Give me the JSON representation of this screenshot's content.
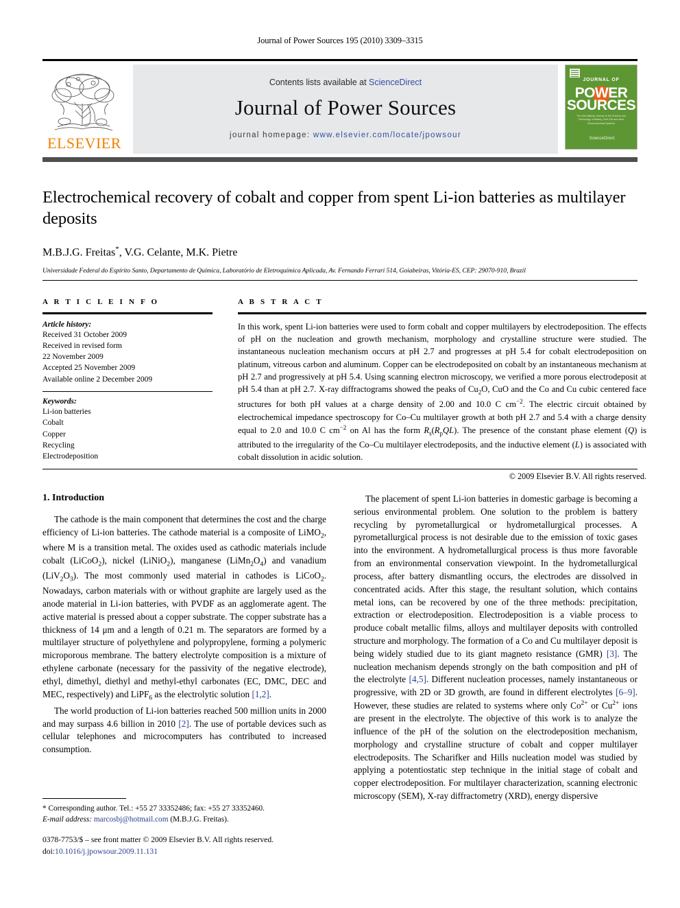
{
  "running_head": "Journal of Power Sources 195 (2010) 3309–3315",
  "masthead": {
    "publisher_name": "ELSEVIER",
    "contents_prefix": "Contents lists available at ",
    "contents_link": "ScienceDirect",
    "journal_name": "Journal of Power Sources",
    "homepage_prefix": "journal homepage: ",
    "homepage_url": "www.elsevier.com/locate/jpowsour",
    "cover": {
      "line1": "JOURNAL OF",
      "line2": "POWER",
      "line3": "SOURCES",
      "subtitle": "The International Journal on the Science and Technology of Battery, Fuel Cell and other Electrochemical Systems",
      "sciencedirect": "ScienceDirect"
    },
    "colors": {
      "elsevier_orange": "#ef8200",
      "link_blue": "#2f4f9f",
      "cover_green": "#5d9733",
      "cover_orange": "#e8601c",
      "band_grey": "#e7e8ea"
    }
  },
  "article": {
    "title": "Electrochemical recovery of cobalt and copper from spent Li-ion batteries as multilayer deposits",
    "authors": "M.B.J.G. Freitas*, V.G. Celante, M.K. Pietre",
    "affiliation": "Universidade Federal do Espírito Santo, Departamento de Química, Laboratório de Eletroquímica Aplicada, Av. Fernando Ferrari 514, Goiabeiras, Vitória-ES, CEP: 29070-910, Brazil"
  },
  "article_info": {
    "heading": "A R T I C L E   I N F O",
    "history_title": "Article history:",
    "history": [
      "Received 31 October 2009",
      "Received in revised form",
      "22 November 2009",
      "Accepted 25 November 2009",
      "Available online 2 December 2009"
    ],
    "keywords_title": "Keywords:",
    "keywords": [
      "Li-ion batteries",
      "Cobalt",
      "Copper",
      "Recycling",
      "Electrodeposition"
    ]
  },
  "abstract": {
    "heading": "A B S T R A C T",
    "text": "In this work, spent Li-ion batteries were used to form cobalt and copper multilayers by electrodeposition. The effects of pH on the nucleation and growth mechanism, morphology and crystalline structure were studied. The instantaneous nucleation mechanism occurs at pH 2.7 and progresses at pH 5.4 for cobalt electrodeposition on platinum, vitreous carbon and aluminum. Copper can be electrodeposited on cobalt by an instantaneous mechanism at pH 2.7 and progressively at pH 5.4. Using scanning electron microscopy, we verified a more porous electrodeposit at pH 5.4 than at pH 2.7. X-ray diffractograms showed the peaks of Cu2O, CuO and the Co and Cu cubic centered face structures for both pH values at a charge density of 2.00 and 10.0 C cm−2. The electric circuit obtained by electrochemical impedance spectroscopy for Co–Cu multilayer growth at both pH 2.7 and 5.4 with a charge density equal to 2.0 and 10.0 C cm−2 on Al has the form Rs(RpQL). The presence of the constant phase element (Q) is attributed to the irregularity of the Co–Cu multilayer electrodeposits, and the inductive element (L) is associated with cobalt dissolution in acidic solution.",
    "copyright": "© 2009 Elsevier B.V. All rights reserved."
  },
  "body": {
    "section_number_title": "1.  Introduction",
    "left_paragraphs": [
      "The cathode is the main component that determines the cost and the charge efficiency of Li-ion batteries. The cathode material is a composite of LiMO2, where M is a transition metal. The oxides used as cathodic materials include cobalt (LiCoO2), nickel (LiNiO2), manganese (LiMn2O4) and vanadium (LiV2O3). The most commonly used material in cathodes is LiCoO2. Nowadays, carbon materials with or without graphite are largely used as the anode material in Li-ion batteries, with PVDF as an agglomerate agent. The active material is pressed about a copper substrate. The copper substrate has a thickness of 14 μm and a length of 0.21 m. The separators are formed by a multilayer structure of polyethylene and polypropylene, forming a polymeric microporous membrane. The battery electrolyte composition is a mixture of ethylene carbonate (necessary for the passivity of the negative electrode), ethyl, dimethyl, diethyl and methyl-ethyl carbonates (EC, DMC, DEC and MEC, respectively) and LiPF6 as the electrolytic solution [1,2].",
      "The world production of Li-ion batteries reached 500 million units in 2000 and may surpass 4.6 billion in 2010 [2]. The use of portable devices such as cellular telephones and microcomputers has contributed to increased consumption."
    ],
    "right_paragraphs": [
      "The placement of spent Li-ion batteries in domestic garbage is becoming a serious environmental problem. One solution to the problem is battery recycling by pyrometallurgical or hydrometallurgical processes. A pyrometallurgical process is not desirable due to the emission of toxic gases into the environment. A hydrometallurgical process is thus more favorable from an environmental conservation viewpoint. In the hydrometallurgical process, after battery dismantling occurs, the electrodes are dissolved in concentrated acids. After this stage, the resultant solution, which contains metal ions, can be recovered by one of the three methods: precipitation, extraction or electrodeposition. Electrodeposition is a viable process to produce cobalt metallic films, alloys and multilayer deposits with controlled structure and morphology. The formation of a Co and Cu multilayer deposit is being widely studied due to its giant magneto resistance (GMR) [3]. The nucleation mechanism depends strongly on the bath composition and pH of the electrolyte [4,5]. Different nucleation processes, namely instantaneous or progressive, with 2D or 3D growth, are found in different electrolytes [6–9]. However, these studies are related to systems where only Co2+ or Cu2+ ions are present in the electrolyte. The objective of this work is to analyze the influence of the pH of the solution on the electrodeposition mechanism, morphology and crystalline structure of cobalt and copper multilayer electrodeposits. The Scharifker and Hills nucleation model was studied by applying a potentiostatic step technique in the initial stage of cobalt and copper electrodeposition. For multilayer characterization, scanning electronic microscopy (SEM), X-ray diffractometry (XRD), energy dispersive"
    ]
  },
  "footnote": {
    "corresponding": "* Corresponding author. Tel.: +55 27 33352486; fax: +55 27 33352460.",
    "email_label": "E-mail address:",
    "email": "marcosbj@hotmail.com",
    "email_owner": "(M.B.J.G. Freitas)."
  },
  "footer": {
    "issn_line": "0378-7753/$ – see front matter © 2009 Elsevier B.V. All rights reserved.",
    "doi_label": "doi:",
    "doi_value": "10.1016/j.jpowsour.2009.11.131"
  }
}
